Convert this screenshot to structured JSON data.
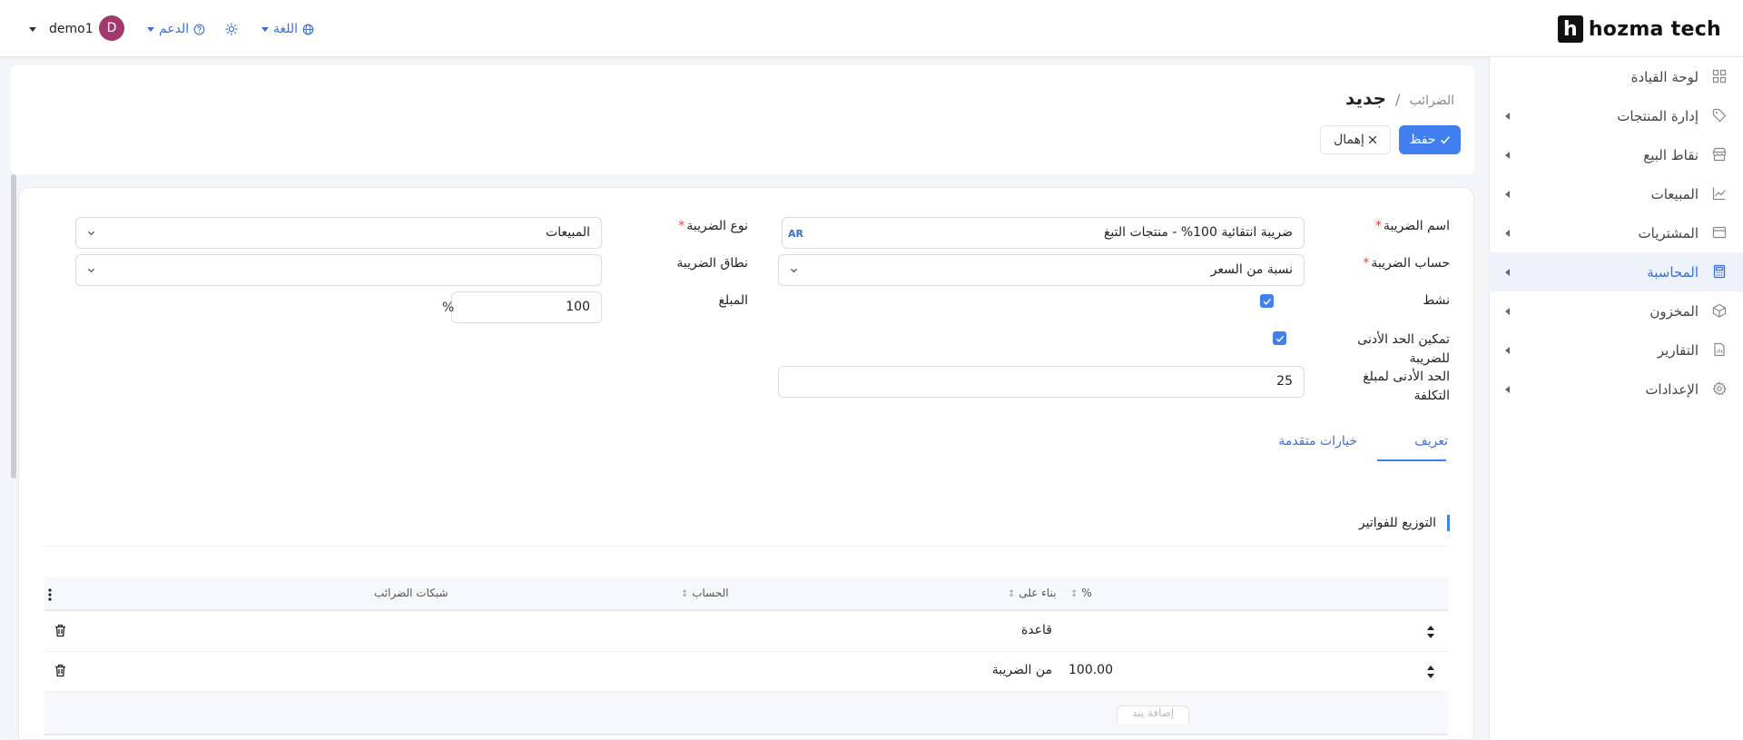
{
  "brand": {
    "name": "hozma tech",
    "mark": "h"
  },
  "topbar": {
    "language": "اللغة",
    "support": "الدعم",
    "user_initial": "D",
    "username": "demo1"
  },
  "sidebar": {
    "items": [
      {
        "label": "لوحة القيادة",
        "icon": "dashboard-icon",
        "expandable": false
      },
      {
        "label": "إدارة المنتجات",
        "icon": "tag-icon",
        "expandable": true
      },
      {
        "label": "نقاط البيع",
        "icon": "store-icon",
        "expandable": true
      },
      {
        "label": "المبيعات",
        "icon": "chart-icon",
        "expandable": true
      },
      {
        "label": "المشتريات",
        "icon": "wallet-icon",
        "expandable": true
      },
      {
        "label": "المحاسبة",
        "icon": "calculator-icon",
        "expandable": true,
        "active": true
      },
      {
        "label": "المخزون",
        "icon": "box-icon",
        "expandable": true
      },
      {
        "label": "التقارير",
        "icon": "report-icon",
        "expandable": true
      },
      {
        "label": "الإعدادات",
        "icon": "gear-icon",
        "expandable": true
      }
    ]
  },
  "header": {
    "breadcrumb_parent": "الضرائب",
    "separator": "/",
    "title": "جديد",
    "save_label": "حفظ",
    "discard_label": "إهمال"
  },
  "form": {
    "tax_name": {
      "label": "اسم الضريبة",
      "value": "ضريبة انتقائية 100% - منتجات التبغ",
      "lang_tag": "AR"
    },
    "tax_computation": {
      "label": "حساب الضريبة",
      "value": "نسبة من السعر"
    },
    "active": {
      "label": "نشط",
      "checked": true
    },
    "min_enabled": {
      "label_line1": "تمكين الحد الأدنى",
      "label_line2": "للضريبة",
      "checked": true
    },
    "min_cost": {
      "label_line1": "الحد الأدنى لمبلغ",
      "label_line2": "التكلفة",
      "value": "25"
    },
    "tax_type": {
      "label": "نوع الضريبة",
      "value": "المبيعات"
    },
    "tax_scope": {
      "label": "نطاق الضريبة",
      "value": ""
    },
    "amount": {
      "label": "المبلغ",
      "value": "100",
      "unit": "%"
    }
  },
  "tabs": [
    {
      "label": "تعريف",
      "active": true
    },
    {
      "label": "خيارات متقدمة",
      "active": false
    }
  ],
  "section_title": "التوزيع للفواتير",
  "table": {
    "columns": [
      {
        "label": "%",
        "sort": "↕"
      },
      {
        "label": "بناء على",
        "sort": "↕"
      },
      {
        "label": "الحساب",
        "sort": "↕"
      },
      {
        "label": "شبكات الضرائب",
        "sort": ""
      }
    ],
    "rows": [
      {
        "percent": "",
        "based_on": "قاعدة",
        "account": "",
        "grids": ""
      },
      {
        "percent": "100.00",
        "based_on": "من الضريبة",
        "account": "",
        "grids": ""
      }
    ],
    "add_line_label": "إضافة بند"
  },
  "colors": {
    "accent": "#3f7ff0",
    "avatar": "#a3386e",
    "required": "#e0453a"
  }
}
